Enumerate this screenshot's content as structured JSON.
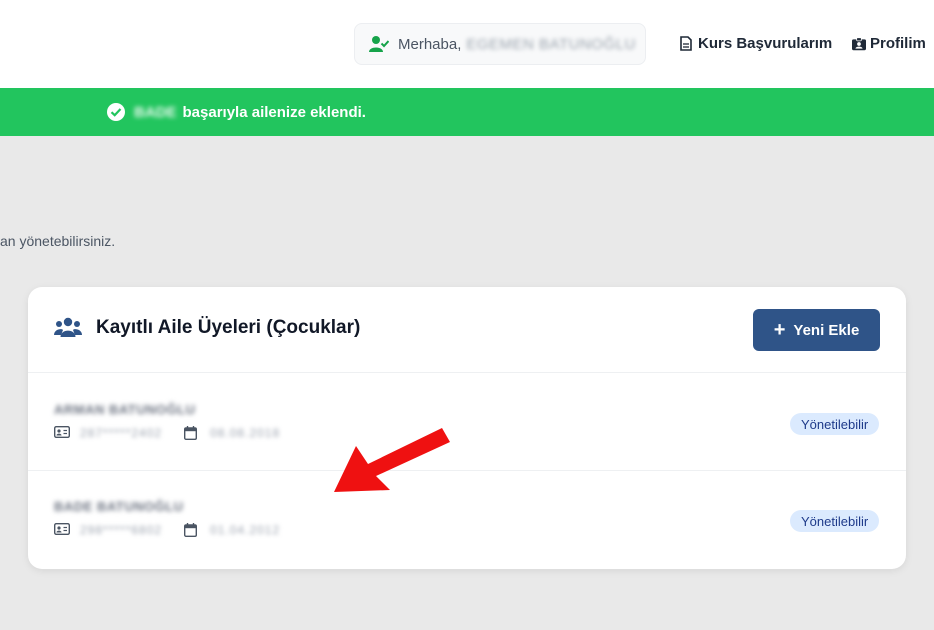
{
  "header": {
    "greeting_prefix": "Merhaba,",
    "user_name": "EGEMEN BATUNOĞLU",
    "nav": [
      {
        "label": "Kurs Başvurularım",
        "icon": "document-icon"
      },
      {
        "label": "Profilim",
        "icon": "id-badge-icon"
      }
    ]
  },
  "alert": {
    "name": "BADE",
    "message": "başarıyla ailenize eklendi.",
    "color": "#22c55e"
  },
  "intro_text": "an yönetebilirsiniz.",
  "family_card": {
    "title": "Kayıtlı Aile Üyeleri (Çocuklar)",
    "add_button_label": "Yeni Ekle",
    "members": [
      {
        "name": "ARMAN BATUNOĞLU",
        "tc_masked": "287*****2402",
        "birth_date": "08.08.2018",
        "status": "Yönetilebilir"
      },
      {
        "name": "BADE BATUNOĞLU",
        "tc_masked": "298*****6802",
        "birth_date": "01.04.2012",
        "status": "Yönetilebilir"
      }
    ]
  },
  "colors": {
    "primary_button": "#2f5488",
    "badge_bg": "#dbeafe",
    "arrow": "#ef1111"
  }
}
